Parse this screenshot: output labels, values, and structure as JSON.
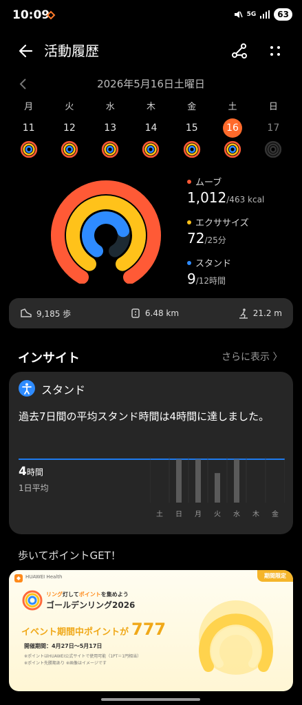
{
  "status": {
    "time": "10:09",
    "net": "5G",
    "battery": "63"
  },
  "header": {
    "title": "活動履歴"
  },
  "date_label": "2026年5月16日土曜日",
  "week": [
    {
      "dow": "月",
      "num": "11",
      "state": "past"
    },
    {
      "dow": "火",
      "num": "12",
      "state": "past"
    },
    {
      "dow": "水",
      "num": "13",
      "state": "past"
    },
    {
      "dow": "木",
      "num": "14",
      "state": "past"
    },
    {
      "dow": "金",
      "num": "15",
      "state": "past"
    },
    {
      "dow": "土",
      "num": "16",
      "state": "selected"
    },
    {
      "dow": "日",
      "num": "17",
      "state": "future"
    }
  ],
  "metrics": {
    "move": {
      "label": "ムーブ",
      "value": "1,012",
      "goal": "/463 kcal",
      "color": "#ff5a36",
      "progress": 1.0
    },
    "exercise": {
      "label": "エクササイズ",
      "value": "72",
      "goal": "/25分",
      "color": "#ffc21a",
      "progress": 1.0
    },
    "stand": {
      "label": "スタンド",
      "value": "9",
      "goal": "/12時間",
      "color": "#2e8bff",
      "progress": 0.75
    }
  },
  "stats": {
    "steps": "9,185 歩",
    "distance": "6.48 km",
    "climb": "21.2 m"
  },
  "insight": {
    "title": "インサイト",
    "more": "さらに表示 〉",
    "card_title": "スタンド",
    "text": "過去7日間の平均スタンド時間は4時間に達しました。",
    "avg_value": "4",
    "avg_unit": "時間",
    "avg_label": "1日平均",
    "chart_days": [
      "土",
      "日",
      "月",
      "火",
      "水",
      "木",
      "金"
    ],
    "chart_values": [
      0,
      9.5,
      9.5,
      6.5,
      9.5,
      0,
      0
    ],
    "chart_avg": 4
  },
  "promo": {
    "section_title": "歩いてポイントGET！",
    "brand": "HUAWEI Health",
    "badge": "期間限定",
    "tagline_1": "リング",
    "tagline_2": "灯して",
    "tagline_3": "ポイント",
    "tagline_4": "を集めよう",
    "campaign": "ゴールデンリング2026",
    "headline": "イベント期間中ポイントが",
    "points": "777",
    "period": "開催期間：4月27日～5月17日",
    "note1": "※ポイントはHUAWEI公式サイトで使用可能（1PT＝1円相当）",
    "note2": "※ポイント先勝期あり ※画像はイメージです"
  }
}
